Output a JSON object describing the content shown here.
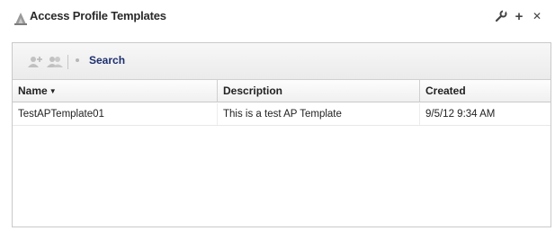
{
  "window": {
    "title": "Access Profile Templates",
    "controls": {
      "settings_icon": "wrench-icon",
      "add_glyph": "+",
      "close_glyph": "✕"
    }
  },
  "toolbar": {
    "search_label": "Search",
    "icons": [
      "add-disabled-icon",
      "users-disabled-icon"
    ]
  },
  "table": {
    "columns": [
      {
        "label": "Name",
        "sorted": "desc"
      },
      {
        "label": "Description"
      },
      {
        "label": "Created"
      }
    ],
    "rows": [
      {
        "name": "TestAPTemplate01",
        "description": "This is a test AP Template",
        "created": "9/5/12 9:34 AM"
      }
    ]
  }
}
